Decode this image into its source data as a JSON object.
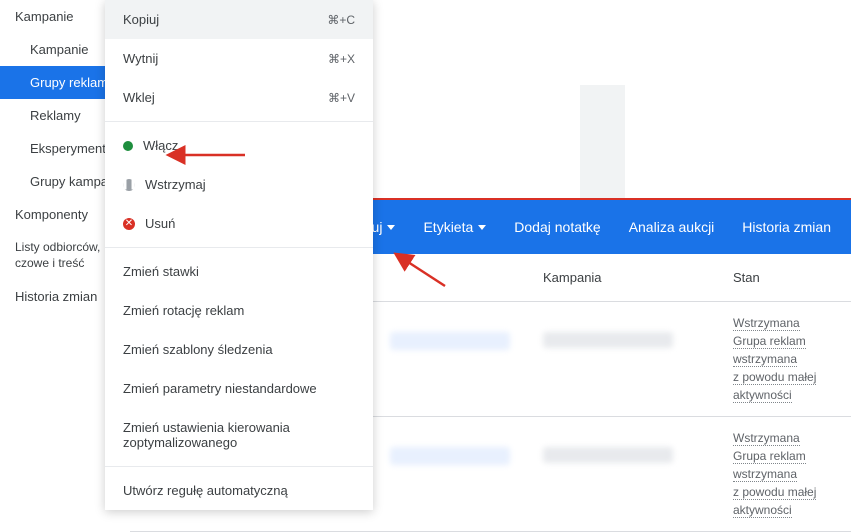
{
  "sidebar": {
    "items": [
      {
        "label": "Kampanie"
      },
      {
        "label": "Kampanie"
      },
      {
        "label": "Grupy reklam"
      },
      {
        "label": "Reklamy"
      },
      {
        "label": "Eksperymenty"
      },
      {
        "label": "Grupy kampanii"
      },
      {
        "label": "Komponenty"
      },
      {
        "label": "Listy odbiorców, czowe i treść"
      },
      {
        "label": "Historia zmian"
      }
    ]
  },
  "toolbar": {
    "edit": "Edytuj",
    "label": "Etykieta",
    "addNote": "Dodaj notatkę",
    "auctionAnalysis": "Analiza aukcji",
    "history": "Historia zmian"
  },
  "table": {
    "headers": {
      "campaign": "Kampania",
      "status": "Stan"
    },
    "rows": [
      {
        "status": "Wstrzymana\nGrupa reklam\nwstrzymana\nz powodu małej\naktywności"
      },
      {
        "status": "Wstrzymana\nGrupa reklam\nwstrzymana\nz powodu małej\naktywności"
      }
    ]
  },
  "contextMenu": {
    "copy": {
      "label": "Kopiuj",
      "shortcut": "⌘+C"
    },
    "cut": {
      "label": "Wytnij",
      "shortcut": "⌘+X"
    },
    "paste": {
      "label": "Wklej",
      "shortcut": "⌘+V"
    },
    "enable": "Włącz",
    "pause": "Wstrzymaj",
    "remove": "Usuń",
    "changeBids": "Zmień stawki",
    "changeRotation": "Zmień rotację reklam",
    "changeTracking": "Zmień szablony śledzenia",
    "changeCustomParams": "Zmień parametry niestandardowe",
    "changeOptimizedTargeting": "Zmień ustawienia kierowania zoptymalizowanego",
    "createRule": "Utwórz regułę automatyczną"
  }
}
